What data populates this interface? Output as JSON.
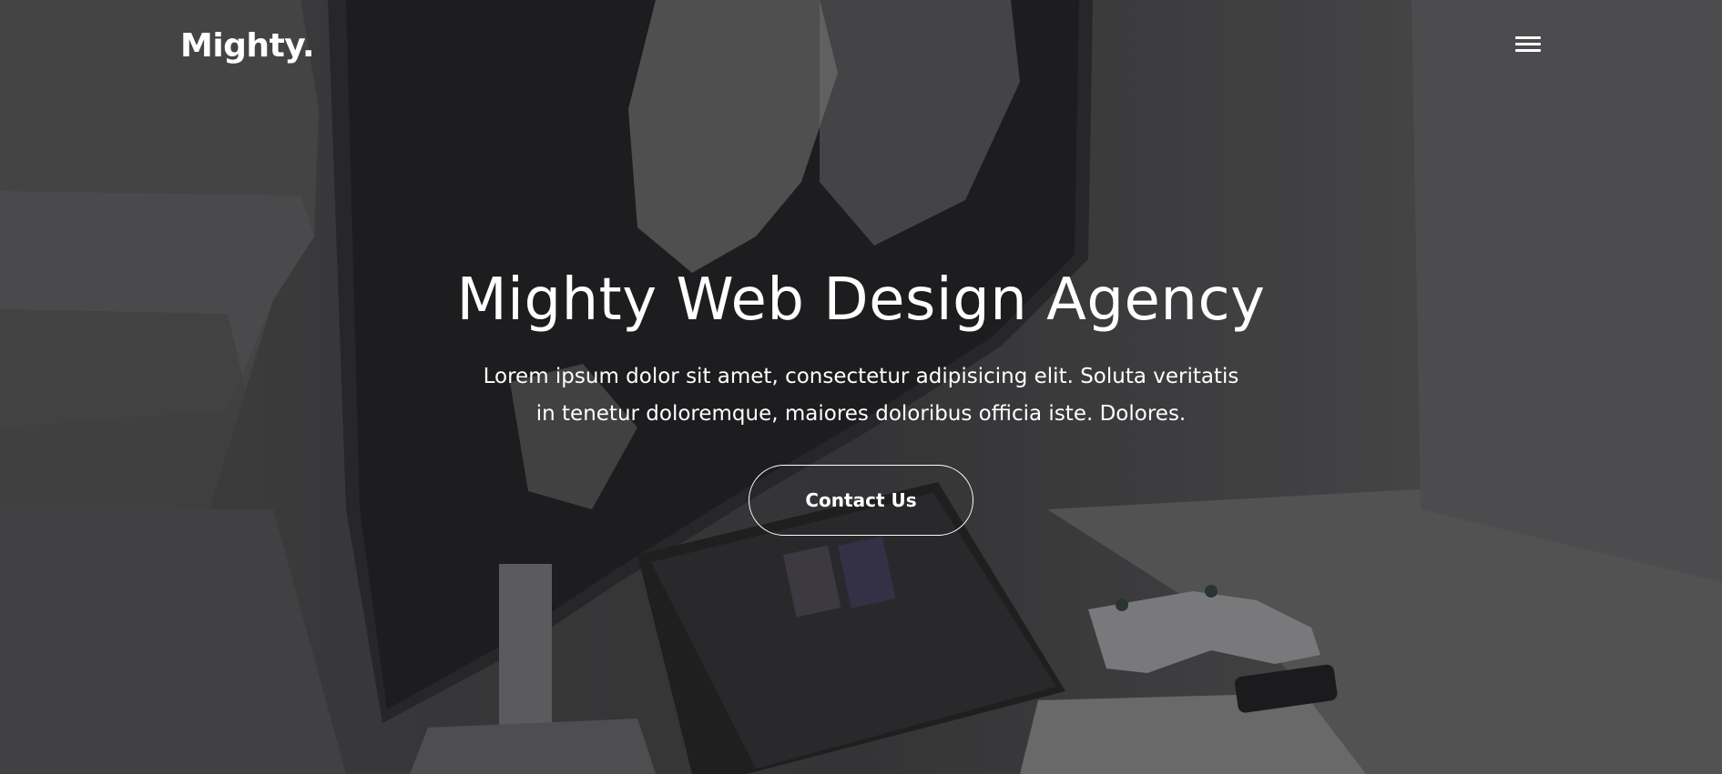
{
  "navbar": {
    "brand": "Mighty.",
    "menu_icon": "hamburger-menu-icon"
  },
  "hero": {
    "title": "Mighty Web Design Agency",
    "text": "Lorem ipsum dolor sit amet, consectetur adipisicing elit. Soluta veritatis in tenetur doloremque, maiores doloribus officia iste. Dolores.",
    "button_label": "Contact Us"
  },
  "colors": {
    "text": "#ffffff",
    "overlay": "#2b2b2d"
  }
}
